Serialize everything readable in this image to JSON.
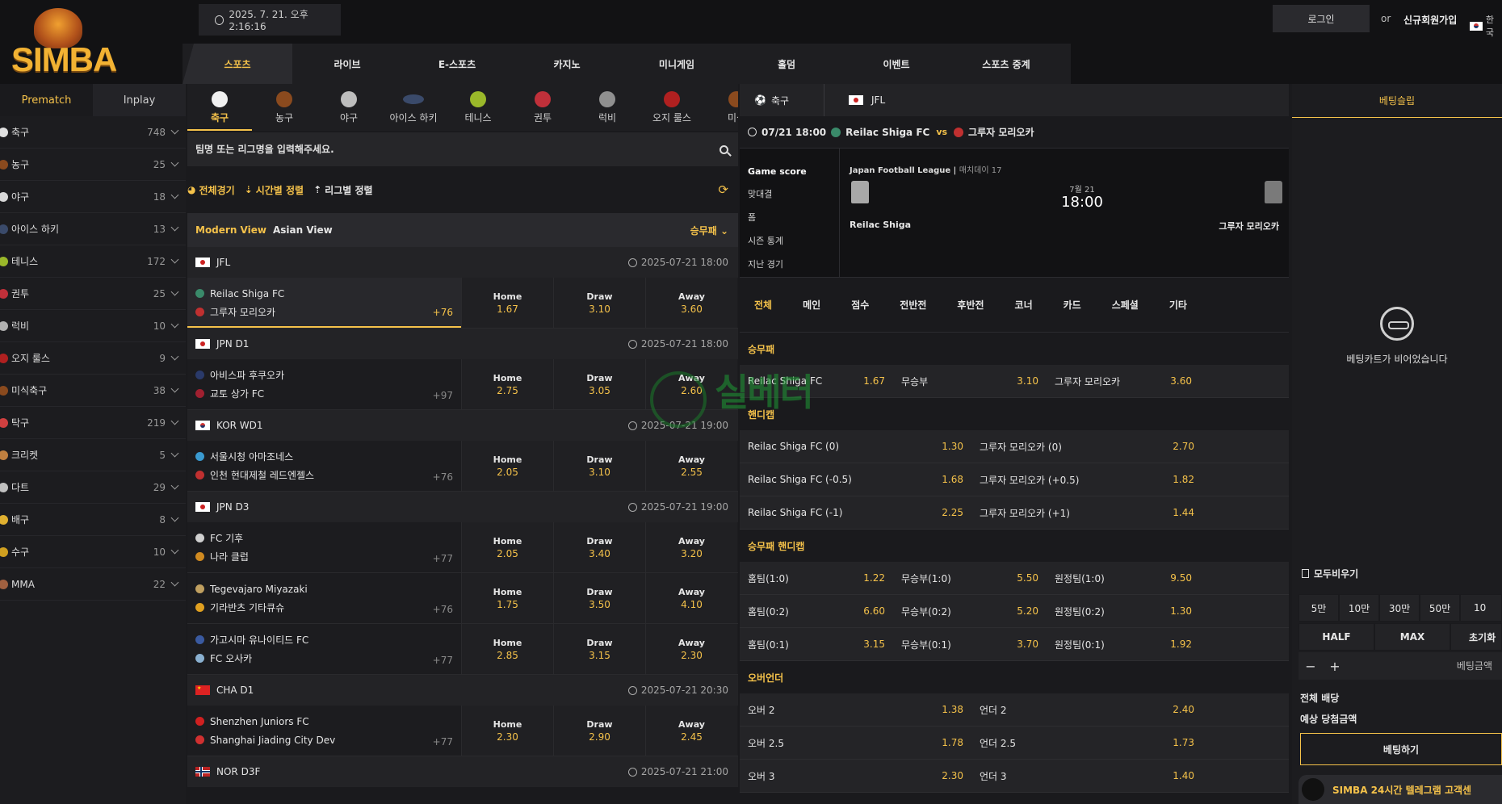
{
  "header": {
    "clock": "2025. 7. 21. 오후 2:16:16",
    "login": "로그인",
    "or": "or",
    "signup": "신규회원가입",
    "lang": "한국",
    "logo_text": "SIMBA",
    "nav": [
      "스포츠",
      "라이브",
      "E-스포츠",
      "카지노",
      "미니게임",
      "홀덤",
      "이벤트",
      "스포츠 중계"
    ]
  },
  "sidebar": {
    "tabs": [
      "Prematch",
      "Inplay"
    ],
    "items": [
      {
        "name": "축구",
        "count": "748",
        "color": "#e0e0e0"
      },
      {
        "name": "농구",
        "count": "25",
        "color": "#8a4a1e"
      },
      {
        "name": "야구",
        "count": "18",
        "color": "#d8d8d8"
      },
      {
        "name": "아이스 하키",
        "count": "13",
        "color": "#3a4a6a"
      },
      {
        "name": "테니스",
        "count": "172",
        "color": "#9ab82a"
      },
      {
        "name": "권투",
        "count": "25",
        "color": "#c0303a"
      },
      {
        "name": "럭비",
        "count": "10",
        "color": "#b0b0b0"
      },
      {
        "name": "오지 룰스",
        "count": "9",
        "color": "#b02020"
      },
      {
        "name": "미식축구",
        "count": "38",
        "color": "#8a4a1e"
      },
      {
        "name": "탁구",
        "count": "219",
        "color": "#d04040"
      },
      {
        "name": "크리켓",
        "count": "5",
        "color": "#c08040"
      },
      {
        "name": "다트",
        "count": "29",
        "color": "#c0c0c0"
      },
      {
        "name": "배구",
        "count": "8",
        "color": "#e0b030"
      },
      {
        "name": "수구",
        "count": "10",
        "color": "#d0a020"
      },
      {
        "name": "MMA",
        "count": "22",
        "color": "#a06040"
      }
    ]
  },
  "sport_tabs": [
    {
      "label": "축구",
      "color": "#f0f0f0"
    },
    {
      "label": "농구",
      "color": "#8a4a1e"
    },
    {
      "label": "야구",
      "color": "#bdbdbd"
    },
    {
      "label": "아이스 하키",
      "color": "#3a4a6a"
    },
    {
      "label": "테니스",
      "color": "#9ab82a"
    },
    {
      "label": "권투",
      "color": "#c0303a"
    },
    {
      "label": "럭비",
      "color": "#909090"
    },
    {
      "label": "오지 룰스",
      "color": "#b02020"
    },
    {
      "label": "미식",
      "color": "#8a4a1e"
    }
  ],
  "search": {
    "placeholder": "팀명 또는 리그명을 입력해주세요."
  },
  "sort": {
    "all": "전체경기",
    "time": "시간별 정렬",
    "league": "리그별 정렬"
  },
  "view": {
    "modern": "Modern View",
    "asian": "Asian View",
    "market": "승무패"
  },
  "odds_labels": {
    "home": "Home",
    "draw": "Draw",
    "away": "Away"
  },
  "leagues": [
    {
      "name": "JFL",
      "time": "2025-07-21 18:00",
      "flag": "jp",
      "matches": [
        {
          "home": "Reilac Shiga FC",
          "away": "그루자 모리오카",
          "more": "+76",
          "h": "1.67",
          "d": "3.10",
          "a": "3.60",
          "sel": true,
          "c1": "#3a8a6a",
          "c2": "#c03030"
        }
      ]
    },
    {
      "name": "JPN D1",
      "time": "2025-07-21 18:00",
      "flag": "jp",
      "matches": [
        {
          "home": "아비스파 후쿠오카",
          "away": "교토 상가 FC",
          "more": "+97",
          "h": "2.75",
          "d": "3.05",
          "a": "2.60",
          "c1": "#2a3a6a",
          "c2": "#a02030"
        }
      ]
    },
    {
      "name": "KOR WD1",
      "time": "2025-07-21 19:00",
      "flag": "kr",
      "matches": [
        {
          "home": "서울시청 아마조네스",
          "away": "인천 현대제철 레드엔젤스",
          "more": "+76",
          "h": "2.05",
          "d": "3.10",
          "a": "2.55",
          "c1": "#3a9ad0",
          "c2": "#c03030"
        }
      ]
    },
    {
      "name": "JPN D3",
      "time": "2025-07-21 19:00",
      "flag": "jp",
      "matches": [
        {
          "home": "FC 기후",
          "away": "나라 클럽",
          "more": "+77",
          "h": "2.05",
          "d": "3.40",
          "a": "3.20",
          "c1": "#d0d0d0",
          "c2": "#d08a20"
        },
        {
          "home": "Tegevajaro Miyazaki",
          "away": "기라반츠 기타큐슈",
          "more": "+76",
          "h": "1.75",
          "d": "3.50",
          "a": "4.10",
          "c1": "#c0a060",
          "c2": "#e0a020"
        },
        {
          "home": "가고시마 유나이티드 FC",
          "away": "FC 오사카",
          "more": "+77",
          "h": "2.85",
          "d": "3.15",
          "a": "2.30",
          "c1": "#3a5aa0",
          "c2": "#8ab0d0"
        }
      ]
    },
    {
      "name": "CHA D1",
      "time": "2025-07-21 20:30",
      "flag": "cn",
      "matches": [
        {
          "home": "Shenzhen Juniors FC",
          "away": "Shanghai Jiading City Dev",
          "more": "+77",
          "h": "2.30",
          "d": "2.90",
          "a": "2.45",
          "c1": "#d02020",
          "c2": "#d03030"
        }
      ]
    },
    {
      "name": "NOR D3F",
      "time": "2025-07-21 21:00",
      "flag": "no",
      "matches": []
    }
  ],
  "detail": {
    "crumb_sport": "축구",
    "crumb_league": "JFL",
    "match_time": "07/21 18:00",
    "home": "Reilac Shiga FC",
    "vs": "vs",
    "away": "그루자 모리오카",
    "score_menu": [
      "Game score",
      "맞대결",
      "폼",
      "시즌 통계",
      "지난 경기"
    ],
    "league_full": "Japan Football League",
    "round": "매치데이 17",
    "date": "7월 21",
    "hour": "18:00",
    "home_short": "Reilac Shiga",
    "away_short": "그루자 모리오카",
    "market_tabs": [
      "전체",
      "메인",
      "점수",
      "전반전",
      "후반전",
      "코너",
      "카드",
      "스페셜",
      "기타"
    ],
    "sections": [
      {
        "title": "승무패",
        "cols": 3,
        "rows": [
          [
            [
              "Reilac Shiga FC",
              "1.67"
            ],
            [
              "무승부",
              "3.10"
            ],
            [
              "그루자 모리오카",
              "3.60"
            ]
          ]
        ]
      },
      {
        "title": "핸디캡",
        "cols": 2,
        "rows": [
          [
            [
              "Reilac Shiga FC (0)",
              "1.30"
            ],
            [
              "그루자 모리오카 (0)",
              "2.70"
            ]
          ],
          [
            [
              "Reilac Shiga FC (-0.5)",
              "1.68"
            ],
            [
              "그루자 모리오카 (+0.5)",
              "1.82"
            ]
          ],
          [
            [
              "Reilac Shiga FC (-1)",
              "2.25"
            ],
            [
              "그루자 모리오카 (+1)",
              "1.44"
            ]
          ]
        ]
      },
      {
        "title": "승무패 핸디캡",
        "cols": 3,
        "rows": [
          [
            [
              "홈팀(1:0)",
              "1.22"
            ],
            [
              "무승부(1:0)",
              "5.50"
            ],
            [
              "원정팀(1:0)",
              "9.50"
            ]
          ],
          [
            [
              "홈팀(0:2)",
              "6.60"
            ],
            [
              "무승부(0:2)",
              "5.20"
            ],
            [
              "원정팀(0:2)",
              "1.30"
            ]
          ],
          [
            [
              "홈팀(0:1)",
              "3.15"
            ],
            [
              "무승부(0:1)",
              "3.70"
            ],
            [
              "원정팀(0:1)",
              "1.92"
            ]
          ]
        ]
      },
      {
        "title": "오버언더",
        "cols": 2,
        "rows": [
          [
            [
              "오버 2",
              "1.38"
            ],
            [
              "언더 2",
              "2.40"
            ]
          ],
          [
            [
              "오버 2.5",
              "1.78"
            ],
            [
              "언더 2.5",
              "1.73"
            ]
          ],
          [
            [
              "오버 3",
              "2.30"
            ],
            [
              "언더 3",
              "1.40"
            ]
          ]
        ]
      }
    ]
  },
  "watermark": "실베터",
  "slip": {
    "title": "베팅슬립",
    "empty": "베팅카트가 비어었습니다",
    "clear": "모두비우기",
    "amounts": [
      "5만",
      "10만",
      "30만",
      "50만",
      "10"
    ],
    "quick": [
      "HALF",
      "MAX",
      "초기화"
    ],
    "stake_placeholder": "베팅금액",
    "total_odds": "전체 배당",
    "expected": "예상 당첨금액",
    "bet": "베팅하기",
    "telegram": "SIMBA 24시간 텔레그램 고객센"
  }
}
